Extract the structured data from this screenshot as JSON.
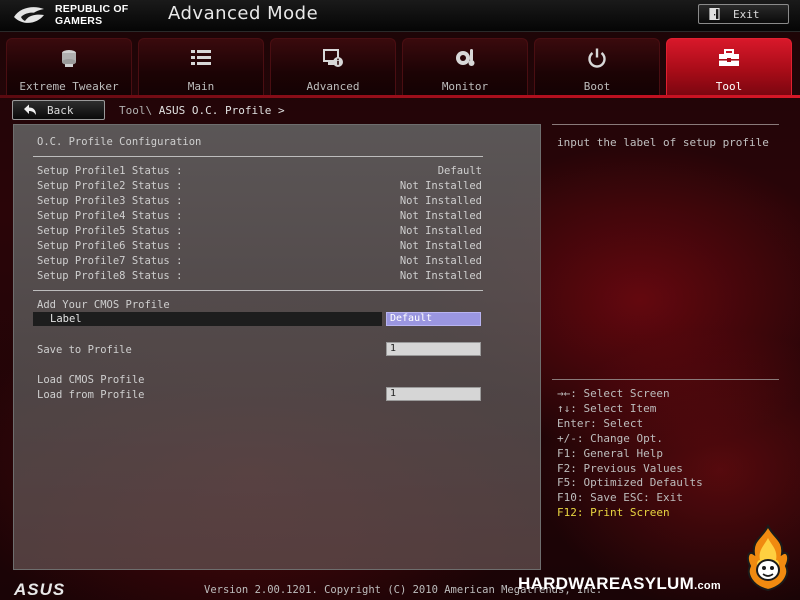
{
  "header": {
    "brand_line1": "REPUBLIC OF",
    "brand_line2": "GAMERS",
    "mode_title": "Advanced Mode",
    "exit_label": "Exit"
  },
  "tabs": [
    {
      "label": "Extreme Tweaker",
      "icon": "extreme-tweaker-icon",
      "active": false
    },
    {
      "label": "Main",
      "icon": "list-icon",
      "active": false
    },
    {
      "label": "Advanced",
      "icon": "advanced-settings-icon",
      "active": false
    },
    {
      "label": "Monitor",
      "icon": "thermometer-gear-icon",
      "active": false
    },
    {
      "label": "Boot",
      "icon": "power-icon",
      "active": false
    },
    {
      "label": "Tool",
      "icon": "toolbox-icon",
      "active": true
    }
  ],
  "breadcrumb": {
    "back_label": "Back",
    "path": "Tool\\",
    "current": "ASUS O.C. Profile >"
  },
  "main": {
    "section_title": "O.C. Profile Configuration",
    "profiles": [
      {
        "label": "Setup Profile1 Status :",
        "value": "Default"
      },
      {
        "label": "Setup Profile2 Status :",
        "value": "Not Installed"
      },
      {
        "label": "Setup Profile3 Status :",
        "value": "Not Installed"
      },
      {
        "label": "Setup Profile4 Status :",
        "value": "Not Installed"
      },
      {
        "label": "Setup Profile5 Status :",
        "value": "Not Installed"
      },
      {
        "label": "Setup Profile6 Status :",
        "value": "Not Installed"
      },
      {
        "label": "Setup Profile7 Status :",
        "value": "Not Installed"
      },
      {
        "label": "Setup Profile8 Status :",
        "value": "Not Installed"
      }
    ],
    "add_heading": "Add Your CMOS Profile",
    "label_field": {
      "label": "Label",
      "value": "Default"
    },
    "save_field": {
      "label": "Save to Profile",
      "value": "1"
    },
    "load_heading": "Load CMOS Profile",
    "load_field": {
      "label": "Load from Profile",
      "value": "1"
    }
  },
  "help": {
    "text": "input the label of setup profile",
    "keys": [
      "→←: Select Screen",
      "↑↓: Select Item",
      "Enter: Select",
      "+/-: Change Opt.",
      "F1: General Help",
      "F2: Previous Values",
      "F5: Optimized Defaults",
      "F10: Save  ESC: Exit",
      "F12: Print Screen"
    ]
  },
  "footer": {
    "asus_logo": "ASUS",
    "version": "Version 2.00.1201. Copyright (C) 2010 American Megatrends, Inc.",
    "watermark_main": "HARDWAREASYLUM",
    "watermark_suffix": ".com"
  },
  "colors": {
    "accent_red": "#d8182a",
    "highlight_key": "#e8d640",
    "selected_field": "#9a96e0"
  }
}
